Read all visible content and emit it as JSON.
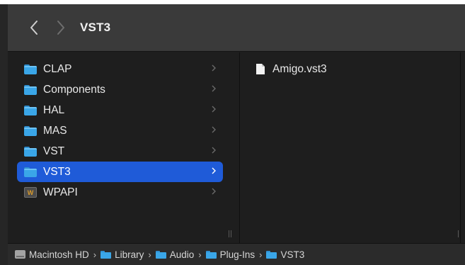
{
  "window": {
    "title": "VST3"
  },
  "sidebar": {
    "items": [
      {
        "label": "CLAP",
        "icon": "folder-icon",
        "selected": false
      },
      {
        "label": "Components",
        "icon": "folder-icon",
        "selected": false
      },
      {
        "label": "HAL",
        "icon": "folder-icon",
        "selected": false
      },
      {
        "label": "MAS",
        "icon": "folder-icon",
        "selected": false
      },
      {
        "label": "VST",
        "icon": "folder-icon",
        "selected": false
      },
      {
        "label": "VST3",
        "icon": "folder-icon",
        "selected": true
      },
      {
        "label": "WPAPI",
        "icon": "wpapi-icon",
        "selected": false
      }
    ]
  },
  "detail": {
    "files": [
      {
        "label": "Amigo.vst3",
        "icon": "document-icon"
      }
    ]
  },
  "pathbar": {
    "crumbs": [
      {
        "label": "Macintosh HD",
        "icon": "hard-drive-icon"
      },
      {
        "label": "Library",
        "icon": "folder-icon"
      },
      {
        "label": "Audio",
        "icon": "folder-icon"
      },
      {
        "label": "Plug-Ins",
        "icon": "folder-icon"
      },
      {
        "label": "VST3",
        "icon": "folder-icon"
      }
    ],
    "separator": "›"
  },
  "colors": {
    "selection": "#1f5bd8",
    "folder": "#3aa6e8",
    "background": "#1e1e1e",
    "toolbar": "#3a3a3a"
  }
}
